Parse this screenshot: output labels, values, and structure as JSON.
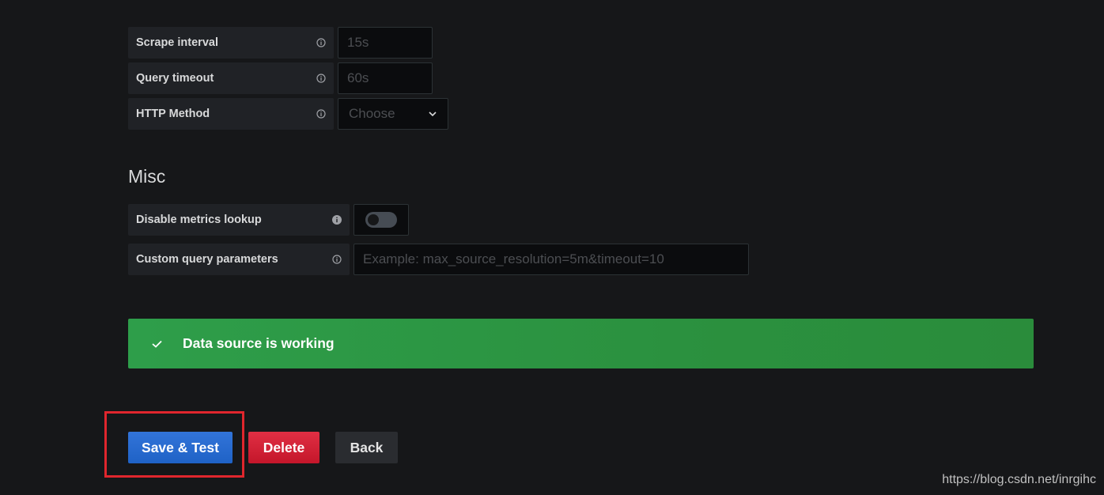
{
  "http_settings": {
    "scrape_interval": {
      "label": "Scrape interval",
      "placeholder": "15s"
    },
    "query_timeout": {
      "label": "Query timeout",
      "placeholder": "60s"
    },
    "http_method": {
      "label": "HTTP Method",
      "selected": "Choose"
    }
  },
  "misc": {
    "title": "Misc",
    "disable_metrics_lookup": {
      "label": "Disable metrics lookup",
      "enabled": false
    },
    "custom_query_parameters": {
      "label": "Custom query parameters",
      "placeholder": "Example: max_source_resolution=5m&timeout=10"
    }
  },
  "alert": {
    "message": "Data source is working",
    "status": "success",
    "color": "#299c46"
  },
  "buttons": {
    "save_test": "Save & Test",
    "delete": "Delete",
    "back": "Back"
  },
  "annotation": {
    "highlight_color": "#e0262d"
  },
  "watermark": "https://blog.csdn.net/inrgihc",
  "icons": {
    "info": "info-circle-icon",
    "check": "check-icon",
    "chevron": "chevron-down-icon"
  }
}
